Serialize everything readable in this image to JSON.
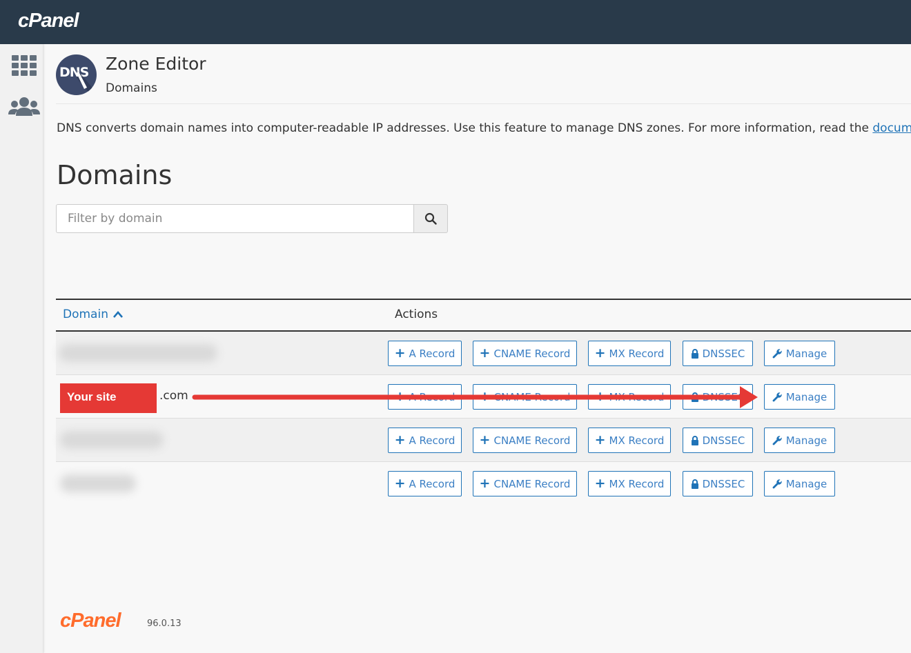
{
  "topbar": {
    "logo": "cPanel"
  },
  "sidebar": {
    "items": [
      {
        "icon": "grid-icon"
      },
      {
        "icon": "users-icon"
      }
    ]
  },
  "header": {
    "icon_text": "DNS",
    "title": "Zone Editor",
    "subtitle": "Domains"
  },
  "description": {
    "text": "DNS converts domain names into computer-readable IP addresses. Use this feature to manage DNS zones. For more information, read the ",
    "link": "documentation"
  },
  "section_title": "Domains",
  "filter": {
    "placeholder": "Filter by domain"
  },
  "table": {
    "col_domain": "Domain",
    "col_actions": "Actions",
    "actions": {
      "a_record": "A Record",
      "cname_record": "CNAME Record",
      "mx_record": "MX Record",
      "dnssec": "DNSSEC",
      "manage": "Manage"
    },
    "rows": [
      {
        "domain": ""
      },
      {
        "domain": ".com"
      },
      {
        "domain": ""
      },
      {
        "domain": ""
      }
    ]
  },
  "annotation": {
    "label": "Your site"
  },
  "footer": {
    "logo": "cPanel",
    "version": "96.0.13"
  },
  "colors": {
    "topbar": "#293a4a",
    "link": "#1f73b7",
    "annotation_red": "#e53935",
    "brand_orange": "#ff6c2c"
  }
}
